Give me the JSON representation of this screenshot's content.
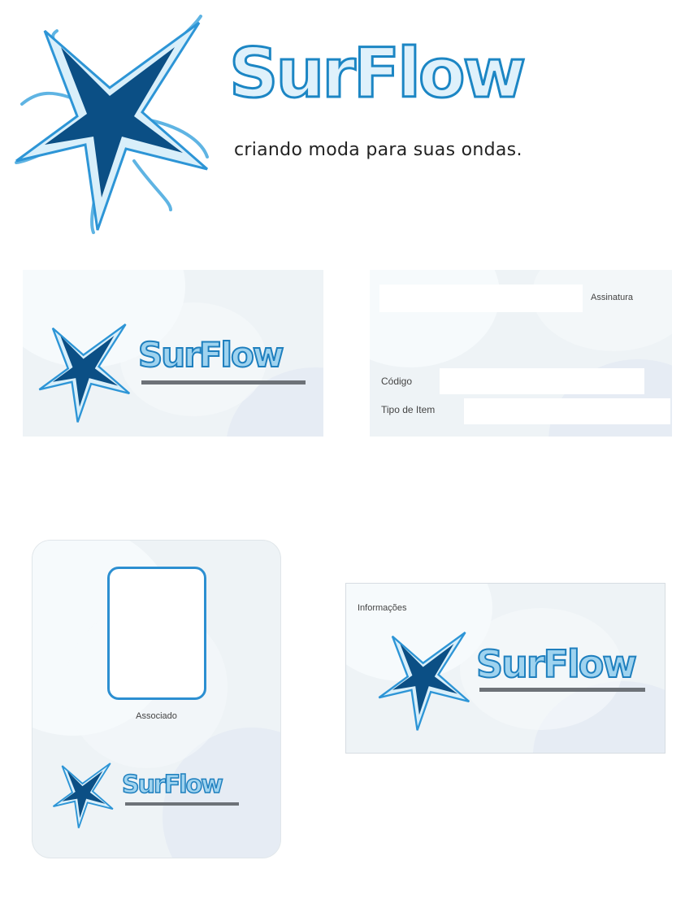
{
  "brand": {
    "name": "SurFlow",
    "tagline": "criando moda para suas ondas."
  },
  "card_back": {
    "field_top_label": "Assinatura",
    "code_label": "Código",
    "type_label": "Tipo de Item"
  },
  "badge": {
    "photo_label": "Associado"
  },
  "small_card": {
    "label": "Informações"
  },
  "colors": {
    "dark_blue": "#0b4f85",
    "mid_blue": "#1e7fbe",
    "light_blue": "#9fd3ef",
    "rule_gray": "#6d7278"
  }
}
